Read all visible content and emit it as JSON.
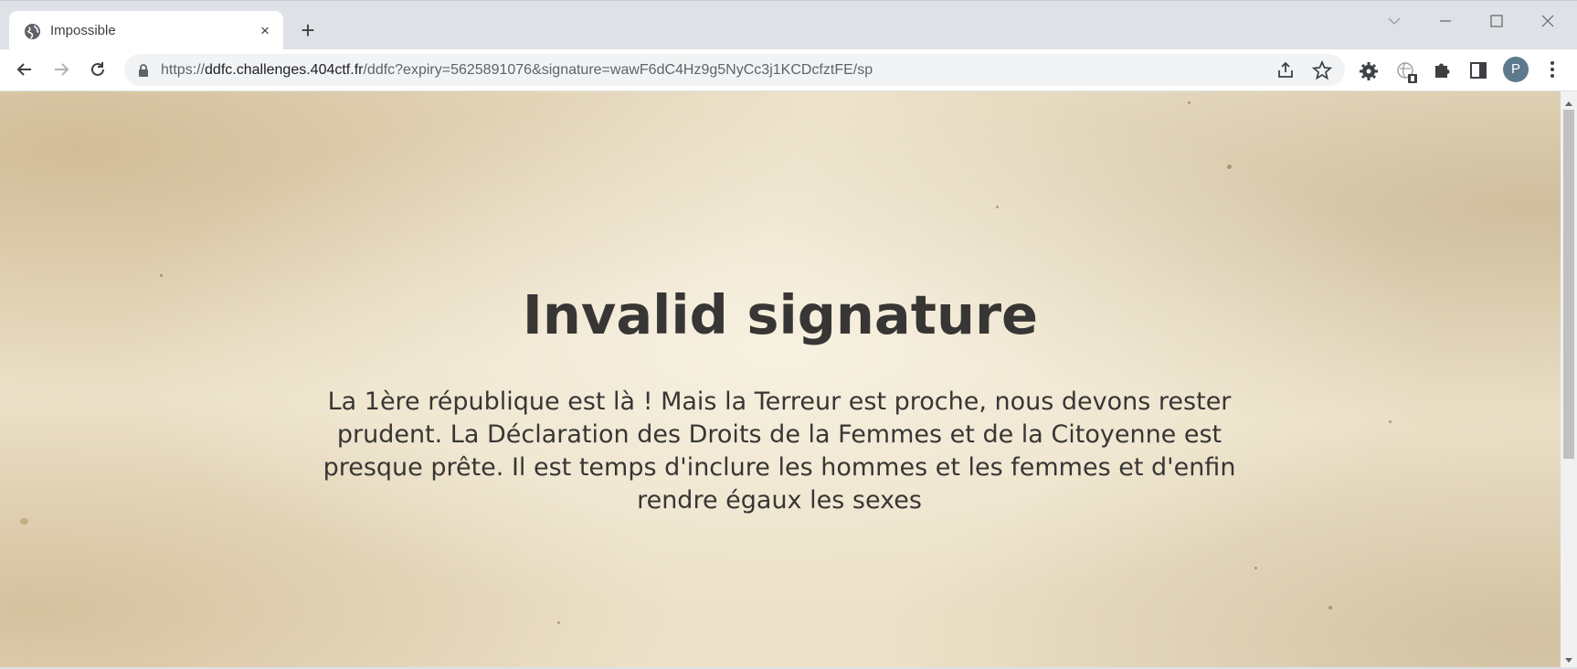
{
  "tab": {
    "title": "Impossible",
    "close_label": "×",
    "new_tab_label": "+"
  },
  "window_controls": [
    "chevron-down-icon",
    "minimize-icon",
    "maximize-icon",
    "close-icon"
  ],
  "toolbar": {
    "url_scheme": "https://",
    "url_host": "ddfc.challenges.404ctf.fr",
    "url_path": "/ddfc?expiry=5625891076&signature=wawF6dC4Hz9g5NyCc3j1KCDcfztFE/sp",
    "profile_initial": "P"
  },
  "page": {
    "heading": "Invalid signature",
    "message": "La 1ère république est là ! Mais la Terreur est proche, nous devons rester prudent. La Déclaration des Droits de la Femmes et de la Citoyenne est presque prête. Il est temps d'inclure les hommes et les femmes et d'enfin rendre égaux les sexes"
  },
  "colors": {
    "accent": "#5c7a8c",
    "paper": "#ece1c8",
    "text": "#383634"
  }
}
